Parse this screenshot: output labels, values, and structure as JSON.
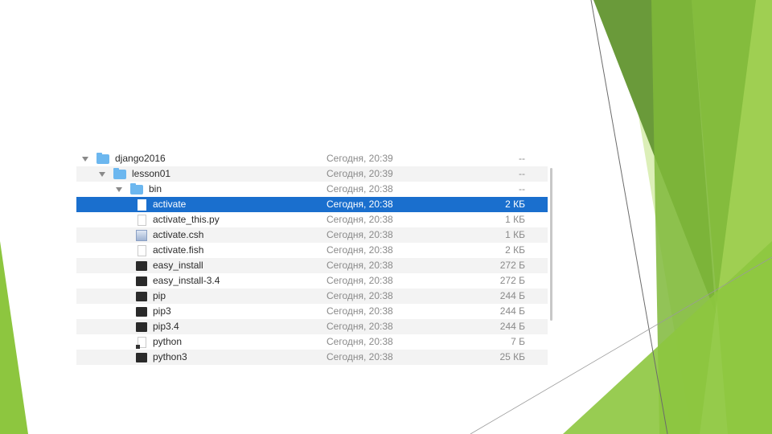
{
  "file_list": {
    "rows": [
      {
        "name": "django2016",
        "date": "Сегодня, 20:39",
        "size": "--",
        "kind": "folder",
        "level": 0,
        "expanded": true,
        "selected": false,
        "icon": "folder-icon"
      },
      {
        "name": "lesson01",
        "date": "Сегодня, 20:39",
        "size": "--",
        "kind": "folder",
        "level": 1,
        "expanded": true,
        "selected": false,
        "icon": "folder-icon"
      },
      {
        "name": "bin",
        "date": "Сегодня, 20:38",
        "size": "--",
        "kind": "folder",
        "level": 2,
        "expanded": true,
        "selected": false,
        "icon": "folder-icon"
      },
      {
        "name": "activate",
        "date": "Сегодня, 20:38",
        "size": "2 КБ",
        "kind": "document",
        "level": 3,
        "selected": true,
        "icon": "document-icon"
      },
      {
        "name": "activate_this.py",
        "date": "Сегодня, 20:38",
        "size": "1 КБ",
        "kind": "document",
        "level": 3,
        "selected": false,
        "icon": "document-icon"
      },
      {
        "name": "activate.csh",
        "date": "Сегодня, 20:38",
        "size": "1 КБ",
        "kind": "script",
        "level": 3,
        "selected": false,
        "icon": "script-icon"
      },
      {
        "name": "activate.fish",
        "date": "Сегодня, 20:38",
        "size": "2 КБ",
        "kind": "document",
        "level": 3,
        "selected": false,
        "icon": "document-icon"
      },
      {
        "name": "easy_install",
        "date": "Сегодня, 20:38",
        "size": "272 Б",
        "kind": "executable",
        "level": 3,
        "selected": false,
        "icon": "terminal-exec-icon"
      },
      {
        "name": "easy_install-3.4",
        "date": "Сегодня, 20:38",
        "size": "272 Б",
        "kind": "executable",
        "level": 3,
        "selected": false,
        "icon": "terminal-exec-icon"
      },
      {
        "name": "pip",
        "date": "Сегодня, 20:38",
        "size": "244 Б",
        "kind": "executable",
        "level": 3,
        "selected": false,
        "icon": "terminal-exec-icon"
      },
      {
        "name": "pip3",
        "date": "Сегодня, 20:38",
        "size": "244 Б",
        "kind": "executable",
        "level": 3,
        "selected": false,
        "icon": "terminal-exec-icon"
      },
      {
        "name": "pip3.4",
        "date": "Сегодня, 20:38",
        "size": "244 Б",
        "kind": "executable",
        "level": 3,
        "selected": false,
        "icon": "terminal-exec-icon"
      },
      {
        "name": "python",
        "date": "Сегодня, 20:38",
        "size": "7 Б",
        "kind": "alias",
        "level": 3,
        "selected": false,
        "icon": "alias-icon"
      },
      {
        "name": "python3",
        "date": "Сегодня, 20:38",
        "size": "25 КБ",
        "kind": "executable",
        "level": 3,
        "selected": false,
        "icon": "terminal-exec-icon"
      }
    ]
  },
  "colors": {
    "selection": "#1a6fce",
    "folder": "#6cb7ef",
    "stripe": "#f3f3f3",
    "green_light": "#cfe6a4",
    "green_mid": "#8dc63f",
    "green_dark": "#5f8f2a"
  }
}
